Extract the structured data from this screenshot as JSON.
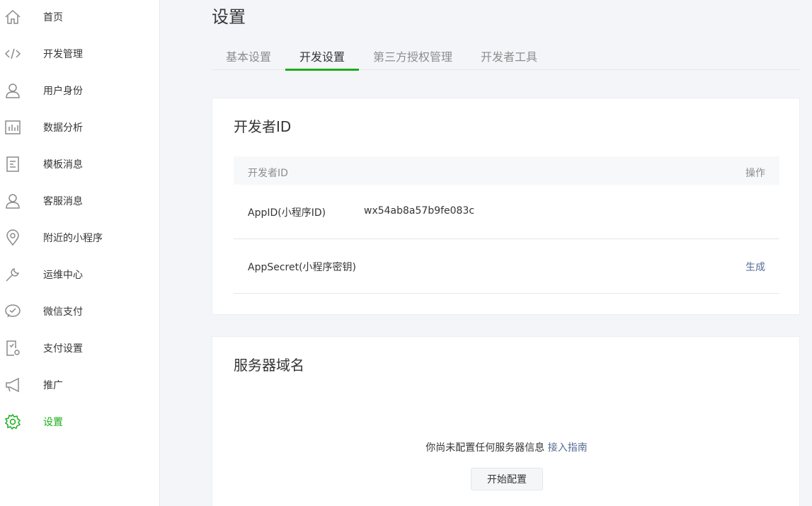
{
  "sidebar": {
    "items": [
      {
        "label": "首页",
        "icon": "home-icon"
      },
      {
        "label": "开发管理",
        "icon": "code-icon"
      },
      {
        "label": "用户身份",
        "icon": "user-icon"
      },
      {
        "label": "数据分析",
        "icon": "chart-icon"
      },
      {
        "label": "模板消息",
        "icon": "template-icon"
      },
      {
        "label": "客服消息",
        "icon": "customer-service-icon"
      },
      {
        "label": "附近的小程序",
        "icon": "location-pin-icon"
      },
      {
        "label": "运维中心",
        "icon": "wrench-icon"
      },
      {
        "label": "微信支付",
        "icon": "wechat-pay-icon"
      },
      {
        "label": "支付设置",
        "icon": "payment-settings-icon"
      },
      {
        "label": "推广",
        "icon": "megaphone-icon"
      },
      {
        "label": "设置",
        "icon": "gear-icon",
        "active": true
      }
    ],
    "active_color": "#1aad19"
  },
  "header": {
    "title": "设置"
  },
  "tabs": [
    {
      "label": "基本设置"
    },
    {
      "label": "开发设置",
      "active": true
    },
    {
      "label": "第三方授权管理"
    },
    {
      "label": "开发者工具"
    }
  ],
  "developer_id": {
    "title": "开发者ID",
    "columns": {
      "id": "开发者ID",
      "action": "操作"
    },
    "rows": [
      {
        "name": "AppID(小程序ID)",
        "value": "wx54ab8a57b9fe083c",
        "action": ""
      },
      {
        "name": "AppSecret(小程序密钥)",
        "value": "",
        "action": "生成"
      }
    ]
  },
  "server_domain": {
    "title": "服务器域名",
    "empty_text": "你尚未配置任何服务器信息",
    "guide_link": "接入指南",
    "start_button": "开始配置"
  },
  "colors": {
    "accent": "#1aad19",
    "link": "#576b95"
  }
}
